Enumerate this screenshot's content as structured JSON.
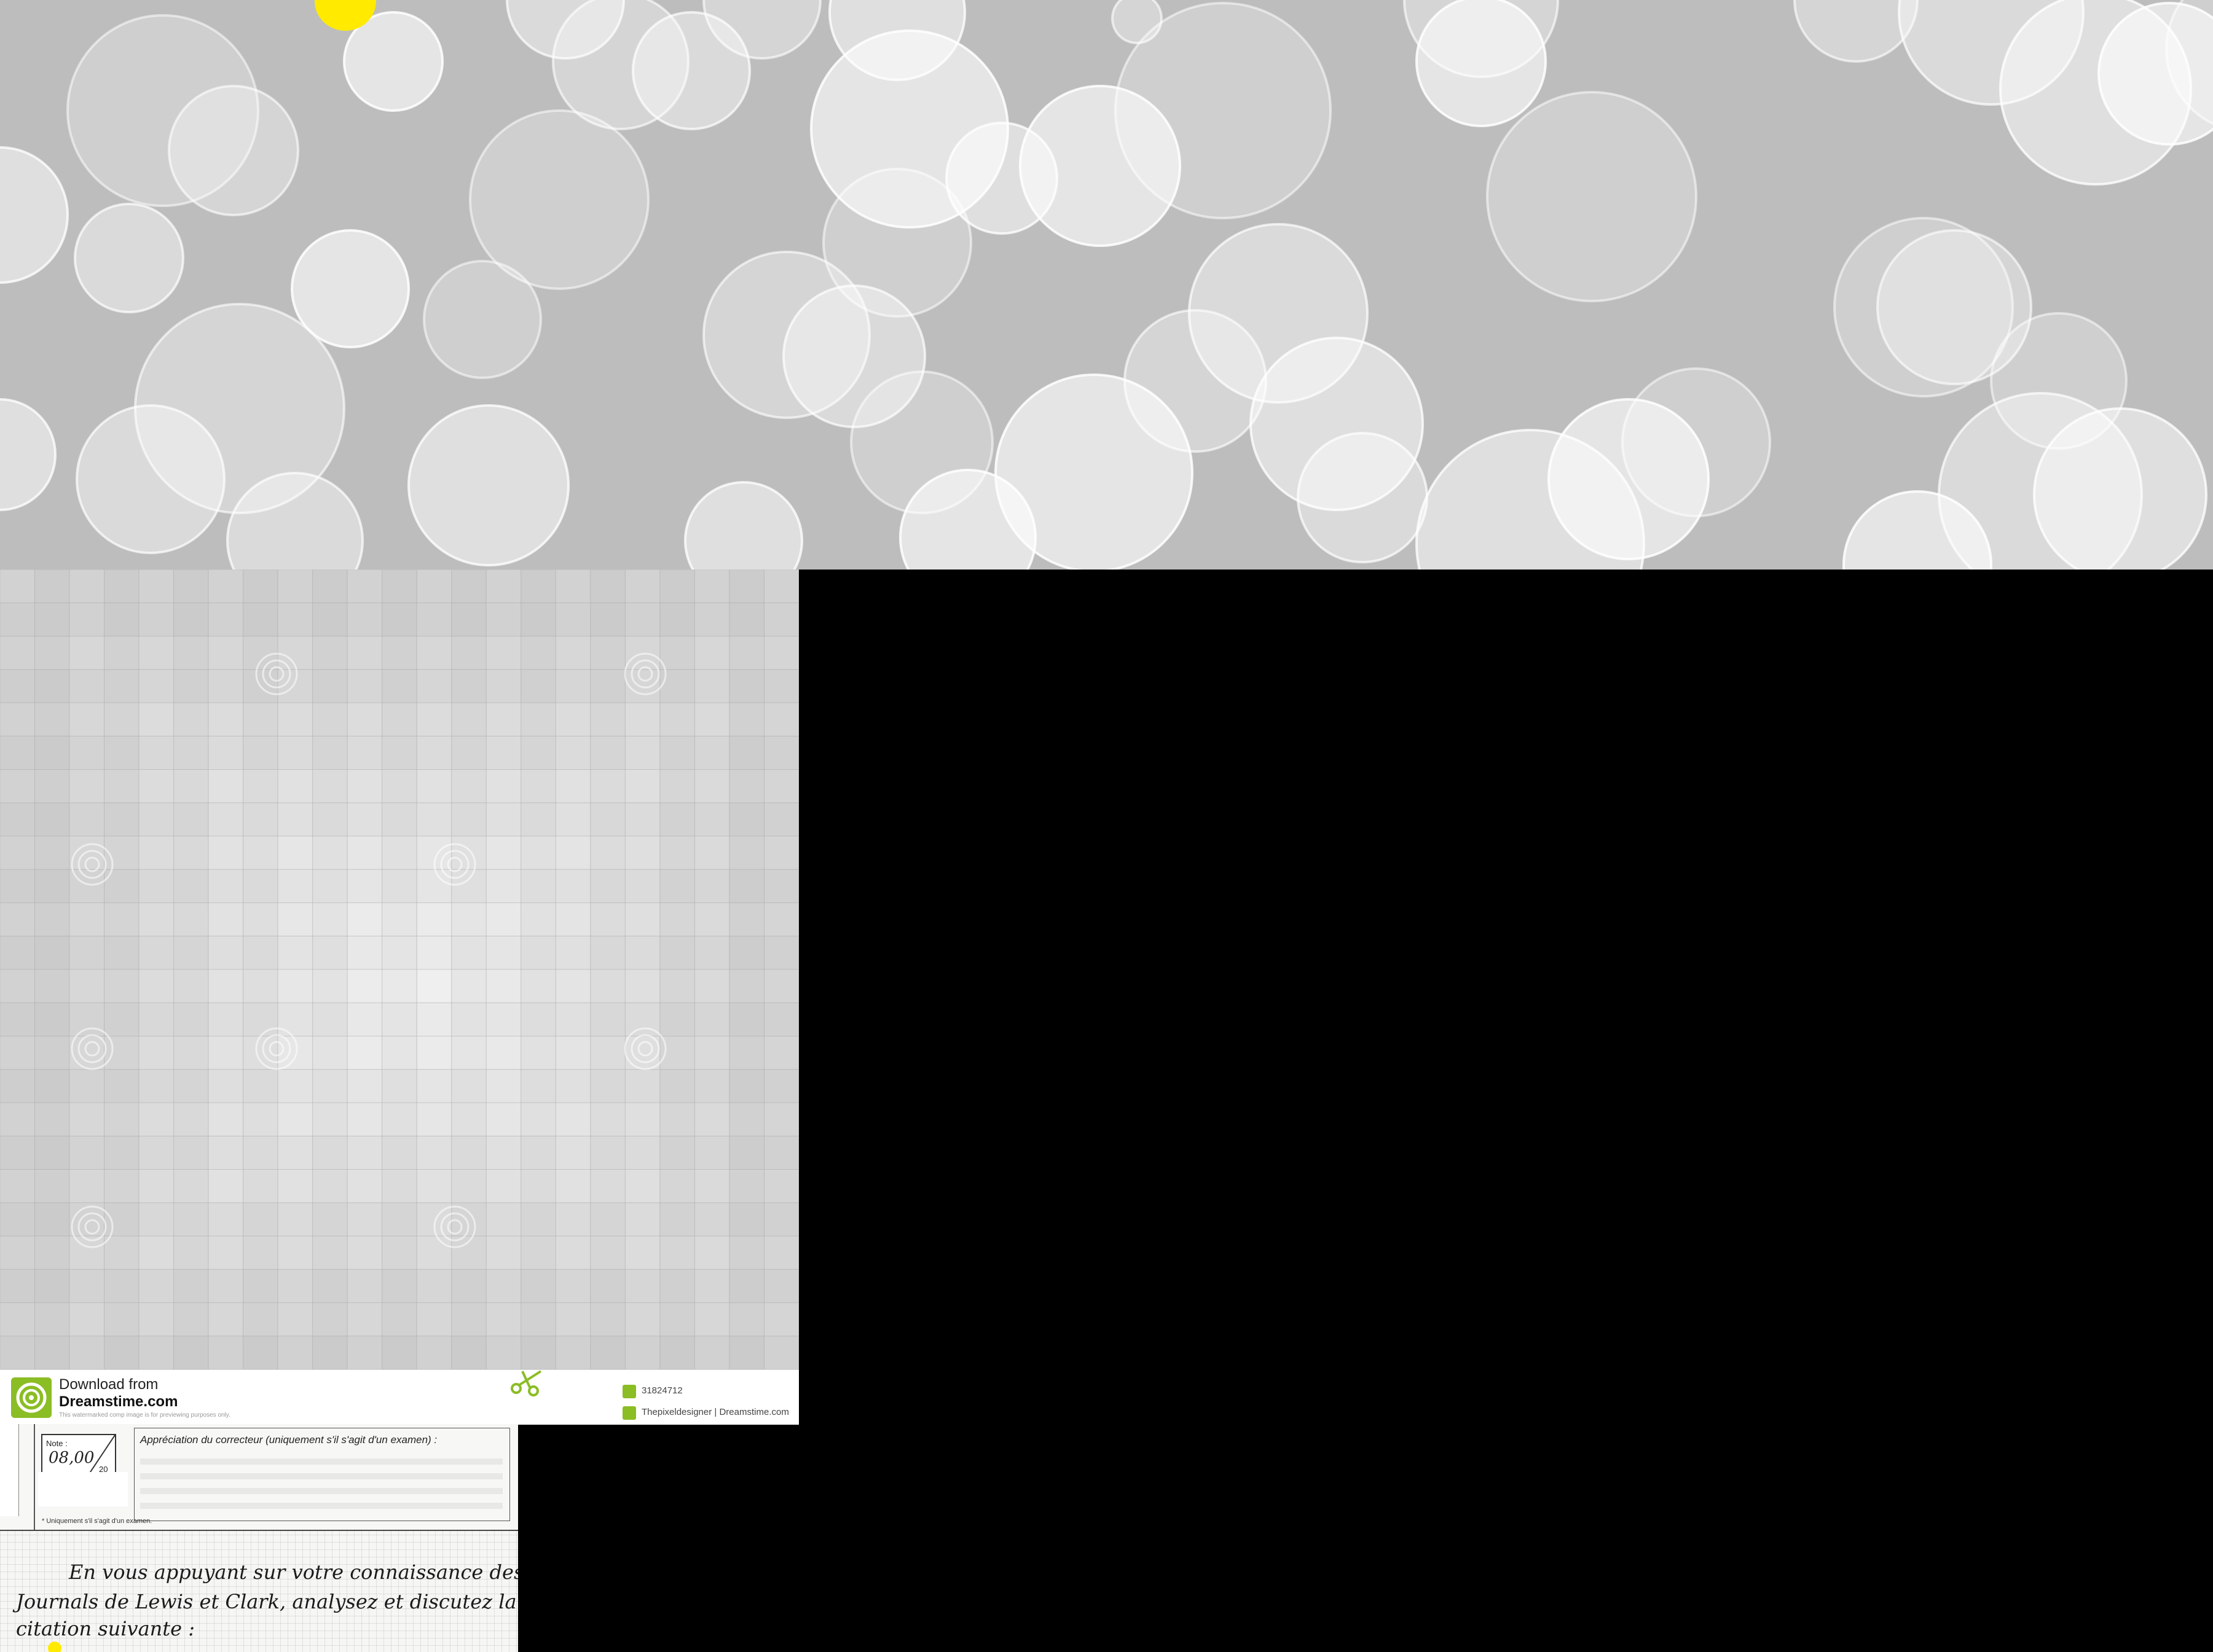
{
  "stock_footer": {
    "download_label": "Download from",
    "site_name": "Dreamstime.com",
    "notice": "This watermarked comp image is for previewing purposes only.",
    "image_id": "31824712",
    "author": "Thepixeldesigner | Dreamstime.com",
    "accent_color": "#8bbd25"
  },
  "exam_sheet": {
    "grade_label": "Note :",
    "grade_value": "08,00",
    "grade_max": "20",
    "appreciation_title": "Appréciation du correcteur (uniquement s'il s'agit d'un examen) :",
    "footnote": "* Uniquement s'il s'agit d'un examen.",
    "handwritten_lines": [
      "En vous appuyant sur votre connaissance des",
      "Journals de Lewis et Clark, analysez et discutez la",
      "citation suivante :"
    ]
  },
  "colors": {
    "bokeh_background": "#bdbdbd",
    "page_background": "#000000",
    "highlight_dot": "#ffea00"
  }
}
